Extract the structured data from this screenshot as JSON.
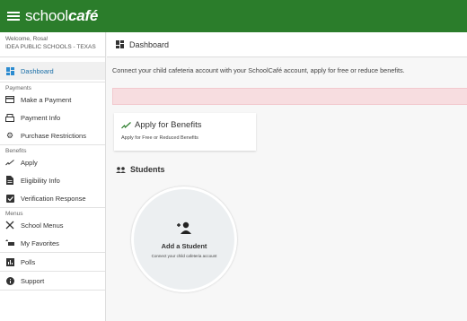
{
  "app": {
    "logo_text_thin": "school",
    "logo_text_bold": "café"
  },
  "sidebar": {
    "welcome_line1": "Welcome, Rosa!",
    "welcome_line2": "IDEA PUBLIC SCHOOLS - TEXAS",
    "dashboard": "Dashboard",
    "sections": {
      "payments": "Payments",
      "benefits": "Benefits",
      "menus": "Menus"
    },
    "items": {
      "make_payment": "Make a Payment",
      "payment_info": "Payment Info",
      "purchase_restrictions": "Purchase Restrictions",
      "apply": "Apply",
      "eligibility_info": "Eligibility Info",
      "verification_response": "Verification Response",
      "school_menus": "School Menus",
      "my_favorites": "My Favorites",
      "polls": "Polls",
      "support": "Support"
    }
  },
  "main": {
    "page_title": "Dashboard",
    "intro_text": "Connect your child cafeteria account with your SchoolCafé account, apply for free or reduce benefits.",
    "benefits_card": {
      "title": "Apply for Benefits",
      "subtitle": "Apply for Free or Reduced Benefits"
    },
    "students_heading": "Students",
    "add_student": {
      "title": "Add a Student",
      "subtitle": "Connect your child cafeteria account"
    }
  },
  "colors": {
    "brand_green": "#2b7d2b",
    "accent_blue": "#2b8bd0",
    "alert_pink": "#f7dde0"
  }
}
